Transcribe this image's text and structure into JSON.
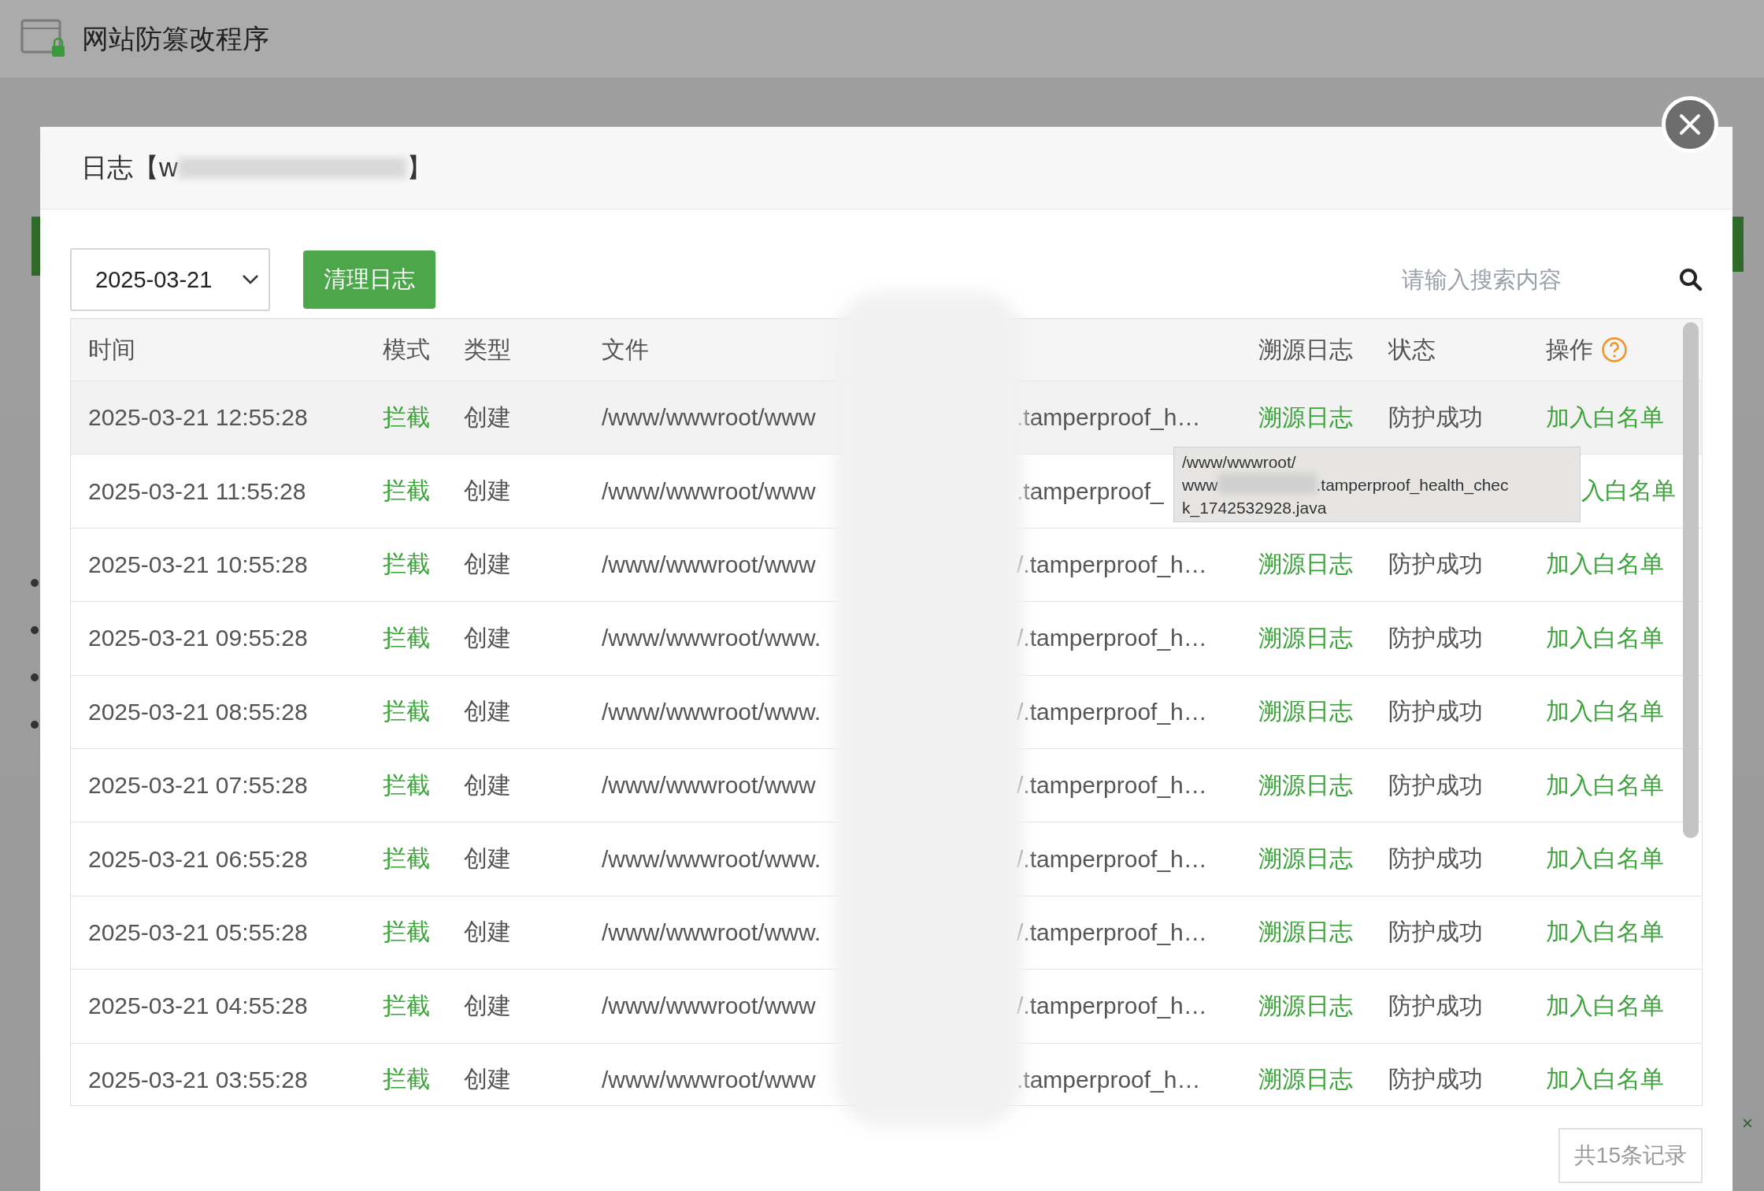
{
  "app": {
    "title": "网站防篡改程序",
    "corner_close": "×"
  },
  "dialog": {
    "title_start": "日志【w",
    "title_end": "】"
  },
  "toolbar": {
    "date": "2025-03-21",
    "clear_button": "清理日志",
    "search": {
      "placeholder": "请输入搜索内容"
    }
  },
  "table": {
    "columns": [
      "时间",
      "模式",
      "类型",
      "文件",
      "溯源日志",
      "状态",
      "操作"
    ],
    "rows": [
      {
        "time": "2025-03-21 12:55:28",
        "mode": "拦截",
        "type": "创建",
        "file_start": "/www/wwwroot/www",
        "file_end": ".tamperproof_h…",
        "trace": "溯源日志",
        "status": "防护成功",
        "action": "加入白名单",
        "selected": true
      },
      {
        "time": "2025-03-21 11:55:28",
        "mode": "拦截",
        "type": "创建",
        "file_start": "/www/wwwroot/www",
        "file_end": ".tamperproof_",
        "action": "入白名单",
        "selected": false
      },
      {
        "time": "2025-03-21 10:55:28",
        "mode": "拦截",
        "type": "创建",
        "file_start": "/www/wwwroot/www",
        "file_end": "/.tamperproof_h…",
        "trace": "溯源日志",
        "status": "防护成功",
        "action": "加入白名单",
        "selected": false
      },
      {
        "time": "2025-03-21 09:55:28",
        "mode": "拦截",
        "type": "创建",
        "file_start": "/www/wwwroot/www.",
        "file_end": "/.tamperproof_h…",
        "trace": "溯源日志",
        "status": "防护成功",
        "action": "加入白名单",
        "selected": false
      },
      {
        "time": "2025-03-21 08:55:28",
        "mode": "拦截",
        "type": "创建",
        "file_start": "/www/wwwroot/www.",
        "file_end": "/.tamperproof_h…",
        "trace": "溯源日志",
        "status": "防护成功",
        "action": "加入白名单",
        "selected": false
      },
      {
        "time": "2025-03-21 07:55:28",
        "mode": "拦截",
        "type": "创建",
        "file_start": "/www/wwwroot/www",
        "file_end": "/.tamperproof_h…",
        "trace": "溯源日志",
        "status": "防护成功",
        "action": "加入白名单",
        "selected": false
      },
      {
        "time": "2025-03-21 06:55:28",
        "mode": "拦截",
        "type": "创建",
        "file_start": "/www/wwwroot/www.",
        "file_end": "/.tamperproof_h…",
        "trace": "溯源日志",
        "status": "防护成功",
        "action": "加入白名单",
        "selected": false
      },
      {
        "time": "2025-03-21 05:55:28",
        "mode": "拦截",
        "type": "创建",
        "file_start": "/www/wwwroot/www.",
        "file_end": "/.tamperproof_h…",
        "trace": "溯源日志",
        "status": "防护成功",
        "action": "加入白名单",
        "selected": false
      },
      {
        "time": "2025-03-21 04:55:28",
        "mode": "拦截",
        "type": "创建",
        "file_start": "/www/wwwroot/www",
        "file_end": "/.tamperproof_h…",
        "trace": "溯源日志",
        "status": "防护成功",
        "action": "加入白名单",
        "selected": false
      },
      {
        "time": "2025-03-21 03:55:28",
        "mode": "拦截",
        "type": "创建",
        "file_start": "/www/wwwroot/www",
        "file_end": ".tamperproof_h…",
        "trace": "溯源日志",
        "status": "防护成功",
        "action": "加入白名单",
        "selected": false
      }
    ]
  },
  "tooltip": {
    "line1": "/www/wwwroot/",
    "line2_start": "www",
    "line2_end": ".tamperproof_health_chec",
    "line3": "k_1742532928.java"
  },
  "footer": {
    "total": "共15条记录"
  }
}
